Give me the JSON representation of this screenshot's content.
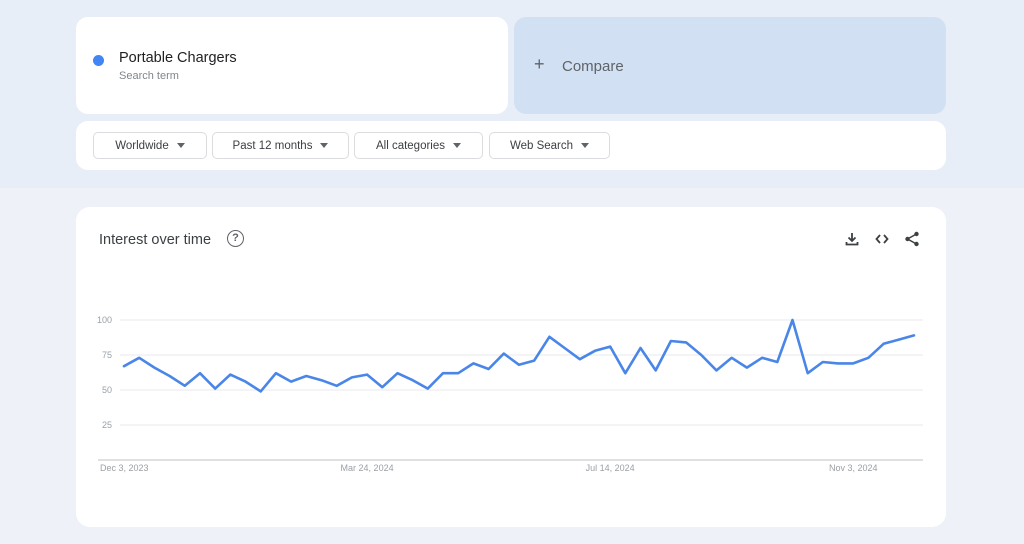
{
  "search_term": {
    "name": "Portable Chargers",
    "subtitle": "Search term",
    "color": "#4285f4"
  },
  "compare": {
    "icon": "plus-icon",
    "label": "Compare"
  },
  "filters": [
    {
      "label": "Worldwide"
    },
    {
      "label": "Past 12 months"
    },
    {
      "label": "All categories"
    },
    {
      "label": "Web Search"
    }
  ],
  "chart_panel": {
    "title": "Interest over time",
    "help_icon": "help-circle-icon",
    "actions": [
      "download-icon",
      "embed-code-icon",
      "share-icon"
    ]
  },
  "chart_data": {
    "type": "line",
    "title": "Interest over time",
    "xlabel": "",
    "ylabel": "",
    "ylim": [
      0,
      100
    ],
    "yticks": [
      25,
      50,
      75,
      100
    ],
    "grid": true,
    "x_tick_labels": [
      {
        "label": "Dec 3, 2023",
        "index": 0
      },
      {
        "label": "Mar 24, 2024",
        "index": 16
      },
      {
        "label": "Jul 14, 2024",
        "index": 32
      },
      {
        "label": "Nov 3, 2024",
        "index": 48
      }
    ],
    "series": [
      {
        "name": "Portable Chargers",
        "color": "#4a86e8",
        "values": [
          67,
          73,
          66,
          60,
          53,
          62,
          51,
          61,
          56,
          49,
          62,
          56,
          60,
          57,
          53,
          59,
          61,
          52,
          62,
          57,
          51,
          62,
          62,
          69,
          65,
          76,
          68,
          71,
          88,
          80,
          72,
          78,
          81,
          62,
          80,
          64,
          85,
          84,
          75,
          64,
          73,
          66,
          73,
          70,
          100,
          62,
          70,
          69,
          69,
          73,
          83,
          86,
          89
        ]
      }
    ]
  }
}
